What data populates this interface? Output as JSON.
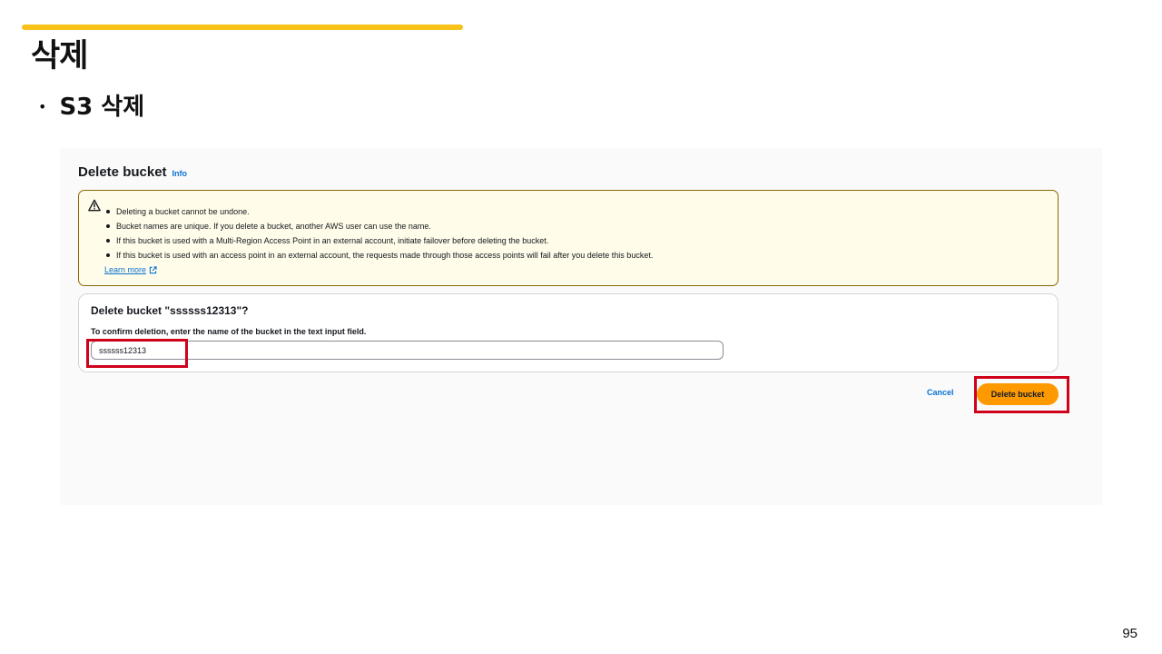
{
  "slide": {
    "title": "삭제",
    "bullet": "S3 삭제",
    "page_number": "95",
    "accent_color": "#f8c21b",
    "highlight_color": "#d0021b"
  },
  "panel": {
    "heading": "Delete bucket",
    "info_link": "Info",
    "alert": {
      "icon": "warning-icon",
      "items": [
        "Deleting a bucket cannot be undone.",
        "Bucket names are unique. If you delete a bucket, another AWS user can use the name.",
        "If this bucket is used with a Multi-Region Access Point in an external account, initiate failover before deleting the bucket.",
        "If this bucket is used with an access point in an external account, the requests made through those access points will fail after you delete this bucket."
      ],
      "learn_more": "Learn more",
      "learn_more_icon": "external-link-icon"
    },
    "confirm": {
      "title": "Delete bucket \"ssssss12313\"?",
      "label": "To confirm deletion, enter the name of the bucket in the text input field.",
      "input_value": "ssssss12313"
    },
    "actions": {
      "cancel": "Cancel",
      "delete": "Delete bucket",
      "delete_color": "#ff9900"
    }
  }
}
